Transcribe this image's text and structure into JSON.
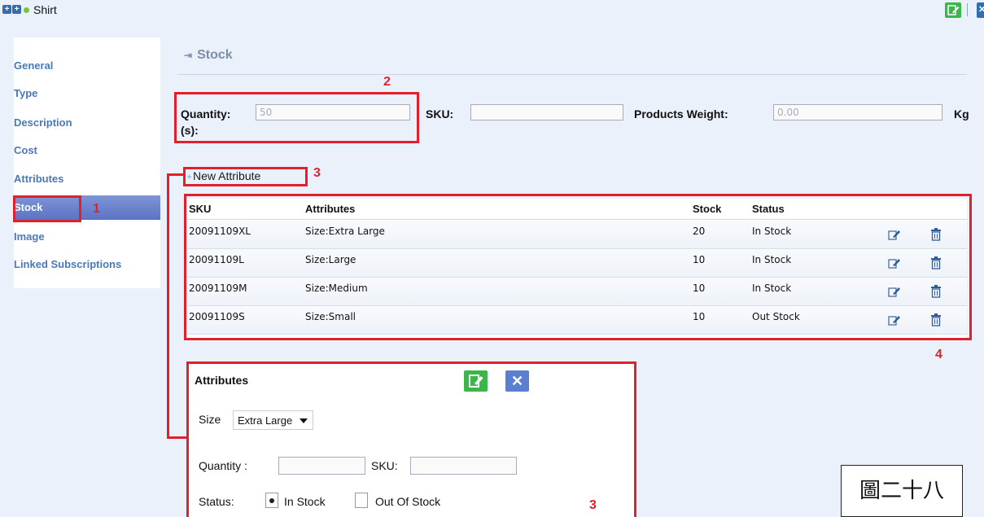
{
  "topbar": {
    "breadcrumb": "Shirt"
  },
  "sidebar": {
    "items": [
      {
        "label": "General"
      },
      {
        "label": "Type"
      },
      {
        "label": "Description"
      },
      {
        "label": "Cost"
      },
      {
        "label": "Attributes"
      },
      {
        "label": "Stock",
        "active": true
      },
      {
        "label": "Image"
      },
      {
        "label": "Linked Subscriptions"
      }
    ]
  },
  "section": {
    "title": "Stock"
  },
  "fields": {
    "quantity_label": "Quantity:",
    "quantity_value": "50",
    "quantity_unit": "(s):",
    "sku_label": "SKU:",
    "sku_value": "",
    "weight_label": "Products Weight:",
    "weight_value": "0.00",
    "weight_unit": "Kg"
  },
  "new_attribute": {
    "label": "New Attribute"
  },
  "stock_table": {
    "headers": [
      "SKU",
      "Attributes",
      "Stock",
      "Status"
    ],
    "rows": [
      {
        "sku": "20091109XL",
        "attributes": "Size:Extra Large",
        "stock": "20",
        "status": "In Stock"
      },
      {
        "sku": "20091109L",
        "attributes": "Size:Large",
        "stock": "10",
        "status": "In Stock"
      },
      {
        "sku": "20091109M",
        "attributes": "Size:Medium",
        "stock": "10",
        "status": "In Stock"
      },
      {
        "sku": "20091109S",
        "attributes": "Size:Small",
        "stock": "10",
        "status": "Out Stock"
      }
    ]
  },
  "attributes_panel": {
    "title": "Attributes",
    "size_label": "Size",
    "size_selected": "Extra Large",
    "quantity_label": "Quantity :",
    "sku_label": "SKU:",
    "status_label": "Status:",
    "status_options": [
      "In Stock",
      "Out Of Stock"
    ],
    "status_selected": "In Stock"
  },
  "annotations": {
    "n1": "1",
    "n2": "2",
    "n3a": "3",
    "n3b": "3",
    "n4": "4"
  },
  "caption": "圖二十八",
  "colors": {
    "accent": "#4a78b8",
    "annotation": "#e0212c",
    "edit_green": "#3cb54a"
  }
}
